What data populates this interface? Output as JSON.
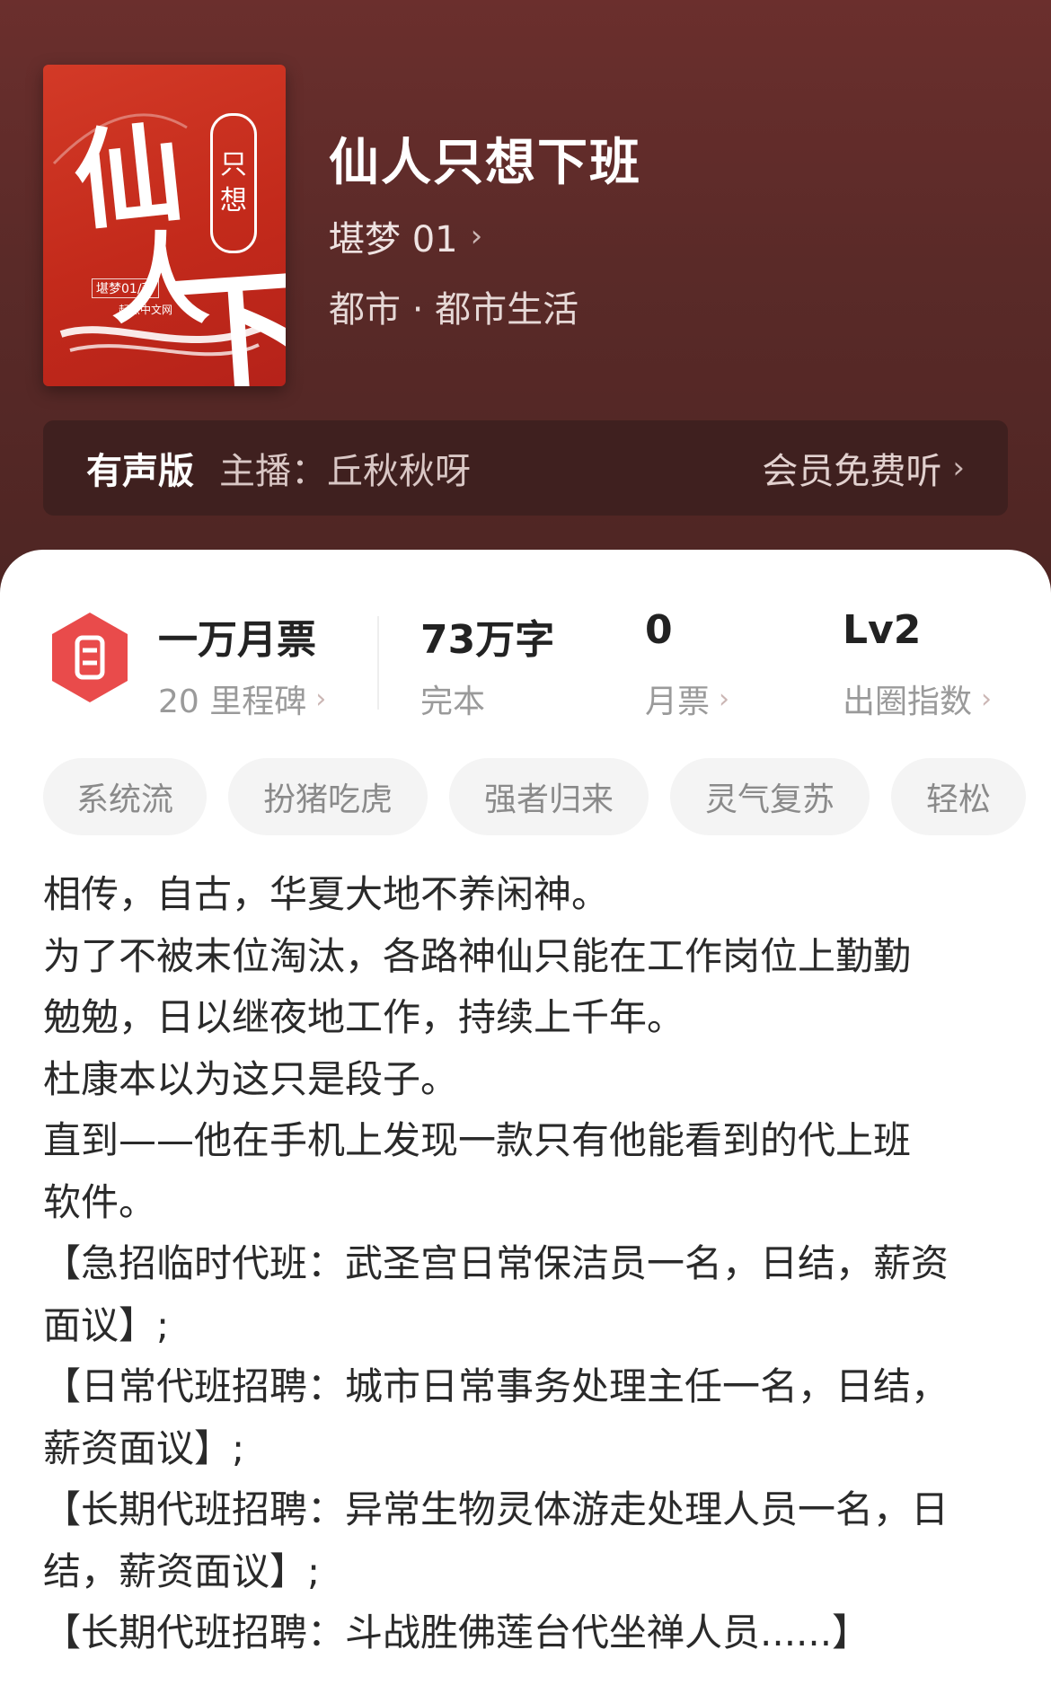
{
  "cover": {
    "badge": [
      "只",
      "想"
    ],
    "title_chars": [
      "仙",
      "人",
      "下班"
    ],
    "author_tag": "堪梦01/著",
    "publisher": "起点中文网"
  },
  "book": {
    "title": "仙人只想下班",
    "author": "堪梦 01",
    "genre": "都市 · 都市生活"
  },
  "audio": {
    "label": "有声版",
    "host": "主播：丘秋秋呀",
    "cta": "会员免费听"
  },
  "stats": {
    "tickets": {
      "main": "一万月票",
      "sub": "20 里程碑"
    },
    "words": {
      "main": "73万字",
      "sub": "完本"
    },
    "monthly": {
      "main": "0",
      "sub": "月票"
    },
    "level": {
      "main": "Lv2",
      "sub": "出圈指数"
    }
  },
  "tags": [
    "系统流",
    "扮猪吃虎",
    "强者归来",
    "灵气复苏",
    "轻松"
  ],
  "synopsis": [
    "相传，自古，华夏大地不养闲神。",
    "为了不被末位淘汰，各路神仙只能在工作岗位上勤勤",
    "勉勉，日以继夜地工作，持续上千年。",
    "杜康本以为这只是段子。",
    "直到——他在手机上发现一款只有他能看到的代上班",
    "软件。",
    "【急招临时代班：武圣宫日常保洁员一名，日结，薪资",
    "面议】;",
    "【日常代班招聘：城市日常事务处理主任一名，日结，",
    "薪资面议】;",
    "【长期代班招聘：异常生物灵体游走处理人员一名，日",
    "结，薪资面议】;",
    "【长期代班招聘：斗战胜佛莲台代坐禅人员......】"
  ],
  "colors": {
    "hero_bg": "#5a2a28",
    "cover_red": "#c32a1b",
    "badge_red": "#e94b4b",
    "text_dark": "#2a2a2a",
    "text_muted": "#9a9a9a"
  },
  "icons": [
    "chevron-right-icon",
    "ticket-badge-icon"
  ]
}
